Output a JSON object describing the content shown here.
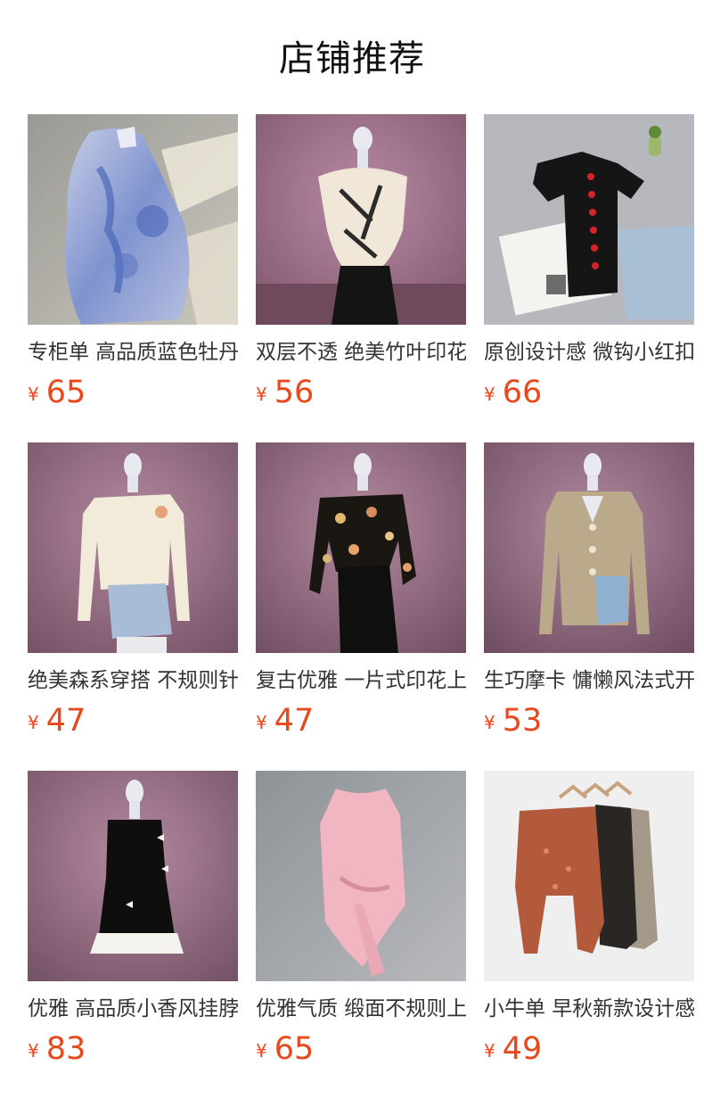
{
  "section": {
    "title": "店铺推荐"
  },
  "currency": "¥",
  "products": [
    {
      "name": "专柜单 高品质蓝色牡丹印花衬衫",
      "price": "65",
      "image": "blue-floral-shirt-photo"
    },
    {
      "name": "双层不透 绝美竹叶印花上衣",
      "price": "56",
      "image": "bamboo-print-top-photo"
    },
    {
      "name": "原创设计感 微钩小红扣针织衫",
      "price": "66",
      "image": "black-knit-red-buttons-photo"
    },
    {
      "name": "绝美森系穿搭 不规则针织上衣",
      "price": "47",
      "image": "cream-knit-top-photo"
    },
    {
      "name": "复古优雅 一片式印花上衣",
      "price": "47",
      "image": "floral-wrap-blouse-photo"
    },
    {
      "name": "生巧摩卡 慵懒风法式开衫",
      "price": "53",
      "image": "beige-cardigan-photo"
    },
    {
      "name": "优雅 高品质小香风挂脖连衣裙",
      "price": "83",
      "image": "black-halter-dress-photo"
    },
    {
      "name": "优雅气质 缎面不规则上衣",
      "price": "65",
      "image": "pink-satin-top-photo"
    },
    {
      "name": "小牛单 早秋新款设计感蕾丝衫",
      "price": "49",
      "image": "lace-tops-hangers-photo"
    }
  ]
}
